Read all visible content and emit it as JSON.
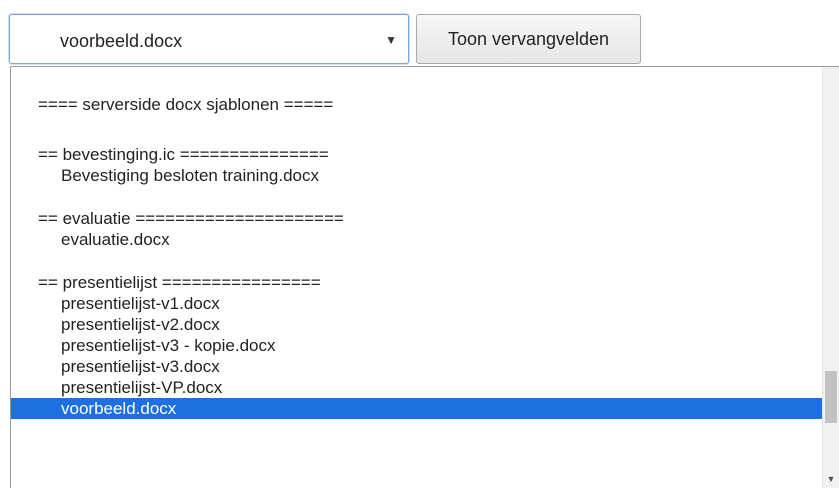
{
  "select": {
    "value": "voorbeeld.docx",
    "arrow": "▼"
  },
  "button": {
    "label": "Toon vervangvelden"
  },
  "options": {
    "header": "==== serverside docx sjablonen =====",
    "g1": "== bevestinging.ic ===============",
    "g1_i1": "Bevestiging besloten training.docx",
    "g2": "== evaluatie =====================",
    "g2_i1": "evaluatie.docx",
    "g3": "== presentielijst ================",
    "g3_i1": "presentielijst-v1.docx",
    "g3_i2": "presentielijst-v2.docx",
    "g3_i3": "presentielijst-v3 - kopie.docx",
    "g3_i4": "presentielijst-v3.docx",
    "g3_i5": "presentielijst-VP.docx",
    "g3_i6": "voorbeeld.docx"
  },
  "scrollbar": {
    "down_arrow": "▼"
  }
}
